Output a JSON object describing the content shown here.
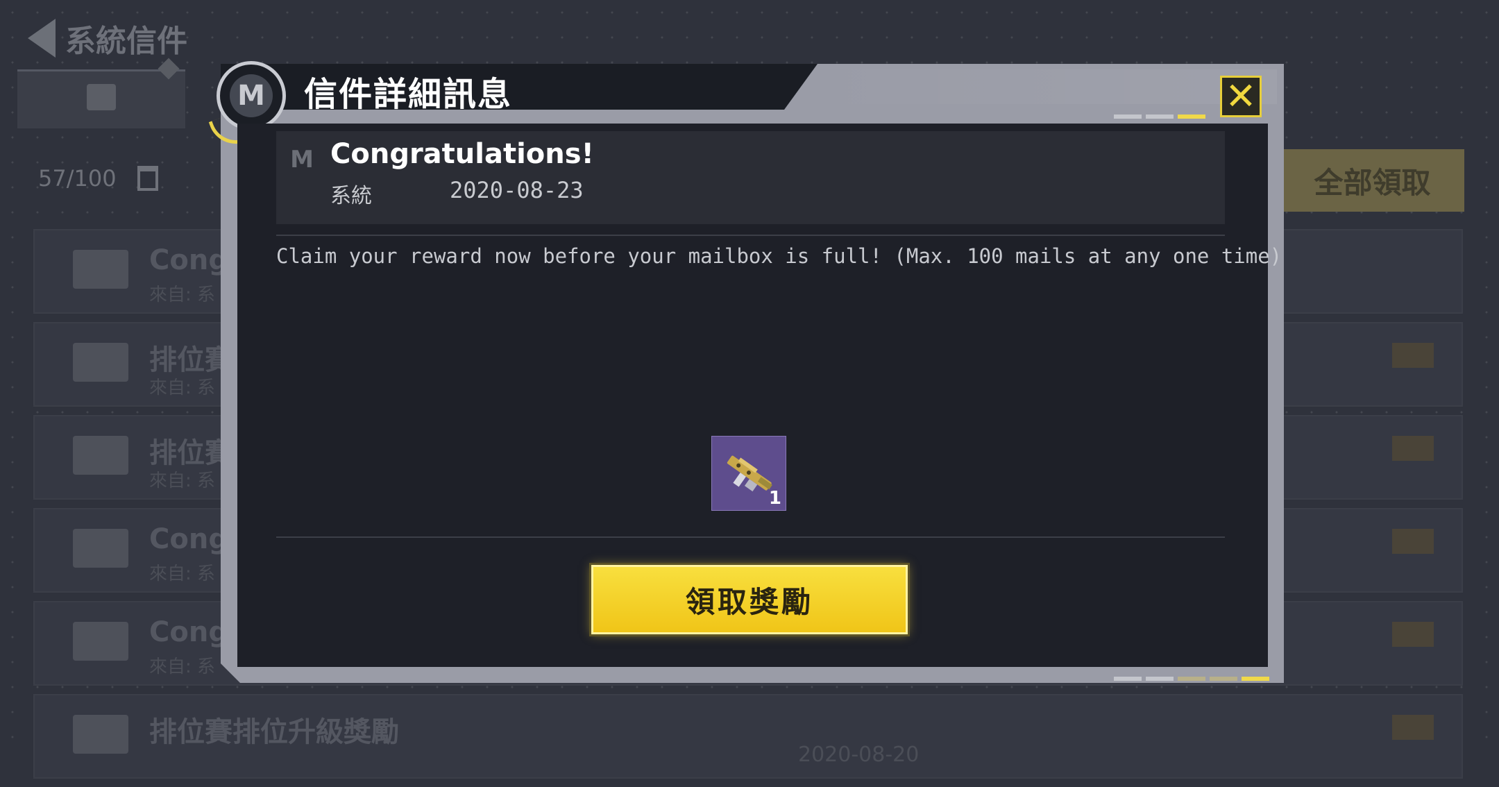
{
  "background": {
    "page_title": "系統信件",
    "mail_count": "57/100",
    "claim_all_label": "全部領取",
    "rows": [
      {
        "title": "Congra",
        "sub": "來自: 系",
        "date": ""
      },
      {
        "title": "排位賽",
        "sub": "來自: 系",
        "date": ""
      },
      {
        "title": "排位賽",
        "sub": "來自: 系",
        "date": ""
      },
      {
        "title": "Congra",
        "sub": "來自: 系",
        "date": ""
      },
      {
        "title": "Congra",
        "sub": "來自: 系",
        "date": ""
      },
      {
        "title": "排位賽排位升級獎勵",
        "sub": "",
        "date": "2020-08-20"
      }
    ]
  },
  "dialog": {
    "title": "信件詳細訊息",
    "close_icon": "close-x",
    "mail": {
      "subject": "Congratulations!",
      "sender": "系統",
      "date": "2020-08-23",
      "body": "Claim your reward now before your mailbox is full! (Max. 100 mails at any one time)"
    },
    "reward": {
      "item_icon": "weapon-icon",
      "quantity": "1"
    },
    "claim_label": "領取獎勵"
  },
  "colors": {
    "accent": "#f0d94a",
    "claim_button": "#f3cf22",
    "reward_bg": "#5e4d8d"
  }
}
